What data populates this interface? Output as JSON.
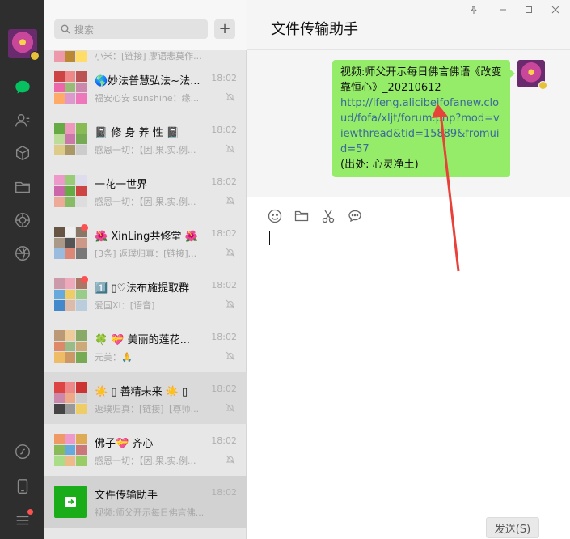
{
  "search": {
    "placeholder": "搜索"
  },
  "chat_window": {
    "title": "文件传输助手",
    "send_label": "发送(S)"
  },
  "chats": [
    {
      "name": "",
      "time": "",
      "preview": "小米：[链接] 廖语悲莫作...",
      "muted": false,
      "unread": false
    },
    {
      "name": "🌎妙法普慧弘法~法...",
      "time": "18:02",
      "preview": "福安心安 sunshine：缘...",
      "muted": true,
      "unread": false
    },
    {
      "name": "📓 修 身 养 性 📓",
      "time": "18:02",
      "preview": "感恩一切：【因.果.实.例...",
      "muted": true,
      "unread": false
    },
    {
      "name": "一花一世界",
      "time": "18:02",
      "preview": "感恩一切：【因.果.实.例...",
      "muted": true,
      "unread": false
    },
    {
      "name": "🌺 XinLing共修堂 🌺",
      "time": "18:02",
      "preview": "[3条] 返璞归真：[链接]...",
      "muted": true,
      "unread": true
    },
    {
      "name": "1️⃣ ▯♡法布施提取群",
      "time": "18:02",
      "preview": "爱国XI：[语音]",
      "muted": true,
      "unread": true
    },
    {
      "name": "🍀 💝 美丽的莲花...",
      "time": "18:02",
      "preview": "元美：🙏",
      "muted": true,
      "unread": false
    },
    {
      "name": "☀️ ▯ 善精未来 ☀️ ▯",
      "time": "18:02",
      "preview": "返璞归真：[链接]【尊师...",
      "muted": true,
      "unread": false
    },
    {
      "name": "佛子💝 齐心",
      "time": "18:02",
      "preview": "感恩一切：【因.果.实.例...",
      "muted": true,
      "unread": false
    },
    {
      "name": "文件传输助手",
      "time": "18:02",
      "preview": "视频:师父开示每日佛言佛...",
      "muted": false,
      "unread": false
    }
  ],
  "message": {
    "line1": "视频:师父开示每日佛言佛语《改变靠恒心》_20210612",
    "link": "http://ifeng.alicibeifofanew.cloud/fofa/xljt/forum.php?mod=viewthread&tid=15889&fromuid=57",
    "source": "(出处: 心灵净土)"
  },
  "colors": {
    "accent": "#07c160",
    "bubble": "#95ec69",
    "annotation_arrow": "#e8413a",
    "link": "#3b6a9a"
  },
  "icons": [
    "chat-icon",
    "contacts-icon",
    "favorites-icon",
    "files-icon",
    "moments-icon",
    "channels-icon",
    "mini-program-icon",
    "phone-icon",
    "menu-icon"
  ]
}
